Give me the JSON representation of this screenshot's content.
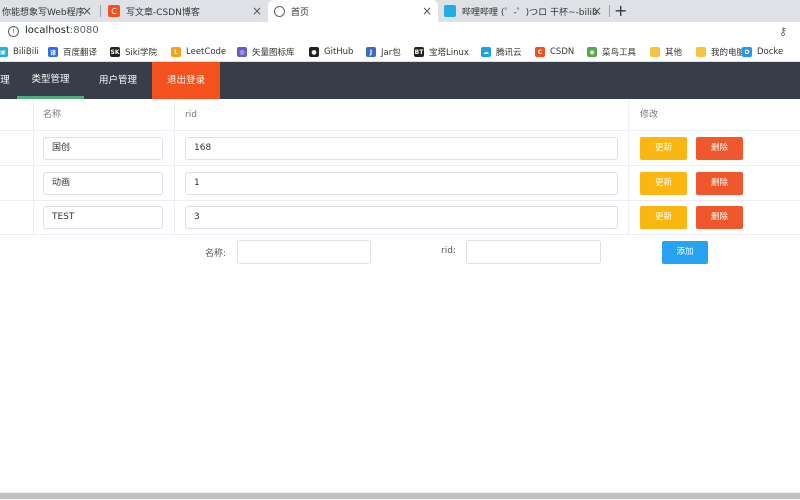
{
  "browser": {
    "tabs": [
      {
        "title": "你能想象写Web程序",
        "favicon_color": "#3a6fd8",
        "favicon_glyph": ""
      },
      {
        "title": "写文章-CSDN博客",
        "favicon_color": "#f4511e",
        "favicon_glyph": "C"
      },
      {
        "title": "首页",
        "favicon_color": "#5f6368",
        "favicon_glyph": "globe-icon"
      },
      {
        "title": "哔哩哔哩 (゜-゜)つロ 干杯~-bilib",
        "favicon_color": "#23ade5",
        "favicon_glyph": "tv-icon"
      }
    ],
    "tab_close_glyph": "×",
    "new_tab_glyph": "+",
    "url_host": "localhost",
    "url_port": ":8080",
    "bookmarks": [
      {
        "label": "BiliBili",
        "color": "#23ade5",
        "glyph": "▣"
      },
      {
        "label": "百度翻译",
        "color": "#2a6df4",
        "glyph": "译"
      },
      {
        "label": "Siki学院",
        "color": "#222222",
        "glyph": "SK"
      },
      {
        "label": "LeetCode",
        "color": "#f89f1b",
        "glyph": "L"
      },
      {
        "label": "矢量图标库",
        "color": "#6b5bd3",
        "glyph": "◎"
      },
      {
        "label": "GitHub",
        "color": "#222222",
        "glyph": "●"
      },
      {
        "label": "Jar包",
        "color": "#3b6bc4",
        "glyph": "J"
      },
      {
        "label": "宝塔Linux",
        "color": "#222222",
        "glyph": "BT"
      },
      {
        "label": "腾讯云",
        "color": "#1ba1e2",
        "glyph": "☁"
      },
      {
        "label": "CSDN",
        "color": "#f4511e",
        "glyph": "C"
      },
      {
        "label": "菜鸟工具",
        "color": "#5aa64a",
        "glyph": "◉"
      },
      {
        "label": "其他",
        "color": "#f6c342",
        "glyph": ""
      },
      {
        "label": "我的电脑",
        "color": "#f6c342",
        "glyph": ""
      },
      {
        "label": "Docke",
        "color": "#2496ed",
        "glyph": "D"
      }
    ]
  },
  "nav": {
    "items": [
      {
        "label": "理"
      },
      {
        "label": "类型管理"
      },
      {
        "label": "用户管理"
      },
      {
        "label": "退出登录"
      }
    ]
  },
  "table": {
    "headers": {
      "name": "名称",
      "rid": "rid",
      "edit": "修改"
    },
    "rows": [
      {
        "name": "国创",
        "rid": "168"
      },
      {
        "name": "动画",
        "rid": "1"
      },
      {
        "name": "TEST",
        "rid": "3"
      }
    ],
    "update_label": "更新",
    "delete_label": "删除"
  },
  "add_form": {
    "name_label": "名称:",
    "rid_label": "rid:",
    "name_value": "",
    "rid_value": "",
    "add_label": "添加"
  },
  "colors": {
    "nav_bg": "#373d49",
    "nav_active_underline": "#4caf7a",
    "logout_bg": "#f4511e",
    "update_btn": "#fbb610",
    "delete_btn": "#f0572c",
    "add_btn": "#27a2f0"
  }
}
